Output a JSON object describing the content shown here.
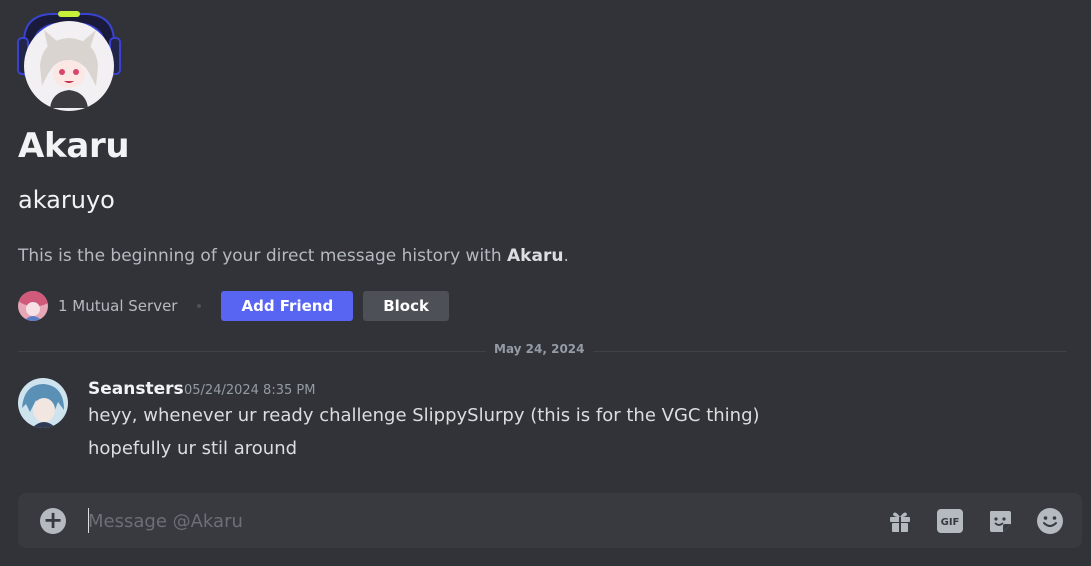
{
  "profile": {
    "display_name": "Akaru",
    "username": "akaruyo",
    "intro_prefix": "This is the beginning of your direct message history with ",
    "intro_name": "Akaru",
    "intro_suffix": ".",
    "mutual_servers": "1 Mutual Server",
    "add_friend_label": "Add Friend",
    "block_label": "Block"
  },
  "divider": {
    "date": "May 24, 2024"
  },
  "messages": [
    {
      "author": "Seansters",
      "timestamp": "05/24/2024 8:35 PM",
      "lines": [
        "heyy, whenever ur ready challenge SlippySlurpy (this is for the VGC thing)",
        "hopefully ur stil around"
      ]
    }
  ],
  "composer": {
    "placeholder": "Message @Akaru"
  },
  "icons": {
    "attach": "plus-circle-icon",
    "gift": "gift-icon",
    "gif": "gif-icon",
    "sticker": "sticker-icon",
    "emoji": "emoji-icon"
  },
  "colors": {
    "background": "#313338",
    "accent": "#5865f2",
    "secondary_button": "#4e5058",
    "composer": "#383a40"
  }
}
